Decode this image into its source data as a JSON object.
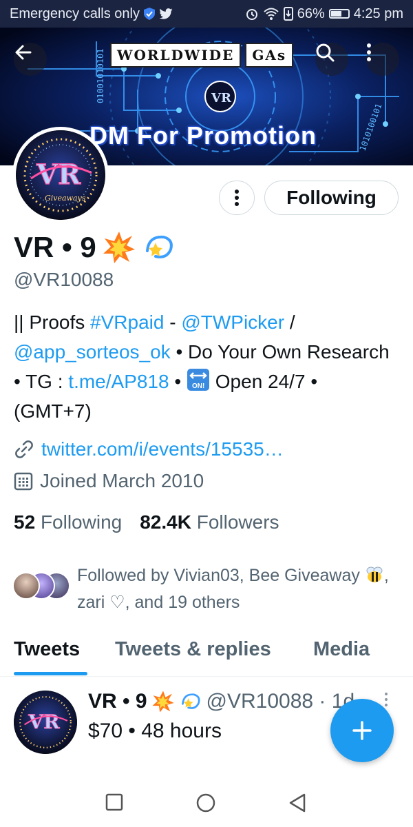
{
  "status_bar": {
    "carrier_text": "Emergency calls only",
    "battery": "66%",
    "battery_level": 0.66,
    "time": "4:25 pm"
  },
  "banner": {
    "title_word1": "WORLDWIDE",
    "title_word2": "GAs",
    "promo": "DM For Promotion",
    "back_icon": "back-arrow-icon",
    "search_icon": "search-icon",
    "more_icon": "more-vertical-icon"
  },
  "profile": {
    "display_name": "VR • 9",
    "name_emojis": [
      "collision-emoji",
      "dizzy-emoji"
    ],
    "handle": "@VR10088",
    "following_button": "Following",
    "bio": {
      "p1": "|| Proofs ",
      "hashtag": "#VRpaid",
      "p2": " - ",
      "mention1": "@TWPicker",
      "p3": " / ",
      "mention2": "@app_sorteos_ok",
      "p4": " • Do Your Own Research • TG : ",
      "tg_link": "t.me/AP818",
      "p5": " • ",
      "p6": " Open 24/7 • (GMT+7)",
      "on_badge": "ON!"
    },
    "url": "twitter.com/i/events/15535…",
    "joined": "Joined March 2010",
    "following_count": "52",
    "following_label": "Following",
    "followers_count": "82.4K",
    "followers_label": "Followers",
    "followed_by_p1": "Followed by Vivian03, Bee Giveaway",
    "followed_by_p2": ", zari ♡, and 19 others"
  },
  "tabs": [
    {
      "label": "Tweets",
      "active": true
    },
    {
      "label": "Tweets & replies",
      "active": false
    },
    {
      "label": "Media",
      "active": false
    }
  ],
  "tweet": {
    "name": "VR • 9",
    "handle": "@VR10088 · 1d",
    "text": "$70 • 48 hours"
  },
  "colors": {
    "accent": "#1d9bf0",
    "text_primary": "#0f1419",
    "text_secondary": "#536471"
  }
}
